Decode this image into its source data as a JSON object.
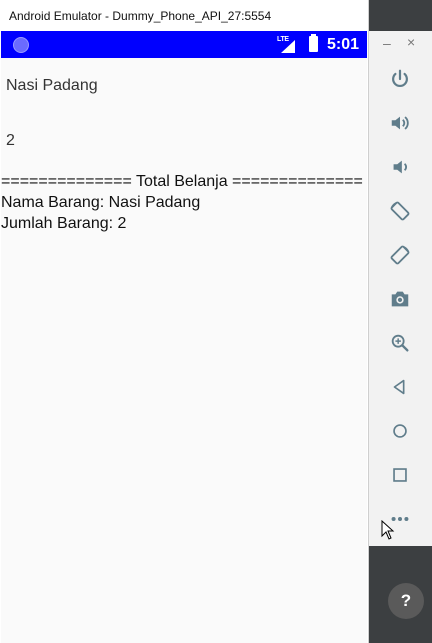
{
  "window": {
    "title": "Android Emulator - Dummy_Phone_API_27:5554"
  },
  "status_bar": {
    "network": "LTE",
    "time": "5:01",
    "color": "#0000ff"
  },
  "app": {
    "name_field": "Nasi Padang",
    "qty_field": "2",
    "result_lines": [
      "============== Total Belanja ==============",
      "Nama Barang: Nasi Padang",
      "Jumlah Barang: 2"
    ]
  },
  "panel": {
    "minimize": "–",
    "close": "×",
    "help": "?",
    "buttons": [
      "power-icon",
      "volume-up-icon",
      "volume-down-icon",
      "rotate-left-icon",
      "rotate-right-icon",
      "camera-icon",
      "zoom-icon",
      "back-icon",
      "home-icon",
      "overview-icon",
      "more-icon"
    ]
  }
}
